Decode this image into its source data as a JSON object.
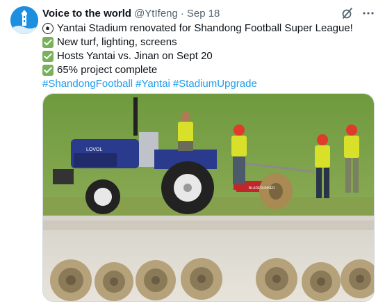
{
  "author": {
    "display_name": "Voice to the world",
    "handle": "@YtIfeng",
    "separator": "·",
    "date": "Sep 18"
  },
  "header_icons": [
    "grok-icon",
    "more-icon"
  ],
  "tweet": {
    "lines": [
      {
        "emoji": "soccer-ball-icon",
        "text": "Yantai Stadium renovated for Shandong Football Super League!"
      },
      {
        "emoji": "check-mark-icon",
        "text": "New turf, lighting, screens"
      },
      {
        "emoji": "check-mark-icon",
        "text": "Hosts Yantai vs. Jinan on Sept 20"
      },
      {
        "emoji": "check-mark-icon",
        "text": "65% project complete"
      }
    ],
    "hashtags": [
      "#ShandongFootball",
      "#Yantai",
      "#StadiumUpgrade"
    ]
  },
  "media": {
    "tractor_brand": "LOVOL",
    "roller_brand": "BLADERUNNER"
  },
  "colors": {
    "link": "#1d9bf0",
    "secondary_text": "#536471",
    "avatar_bg": "#1d8fe1",
    "check_green": "#78b159",
    "tractor_blue": "#2a3a8c",
    "hardhat_red": "#e03a2a",
    "vest_yellow": "#d9e02a",
    "grass": "#7a9e4a"
  }
}
